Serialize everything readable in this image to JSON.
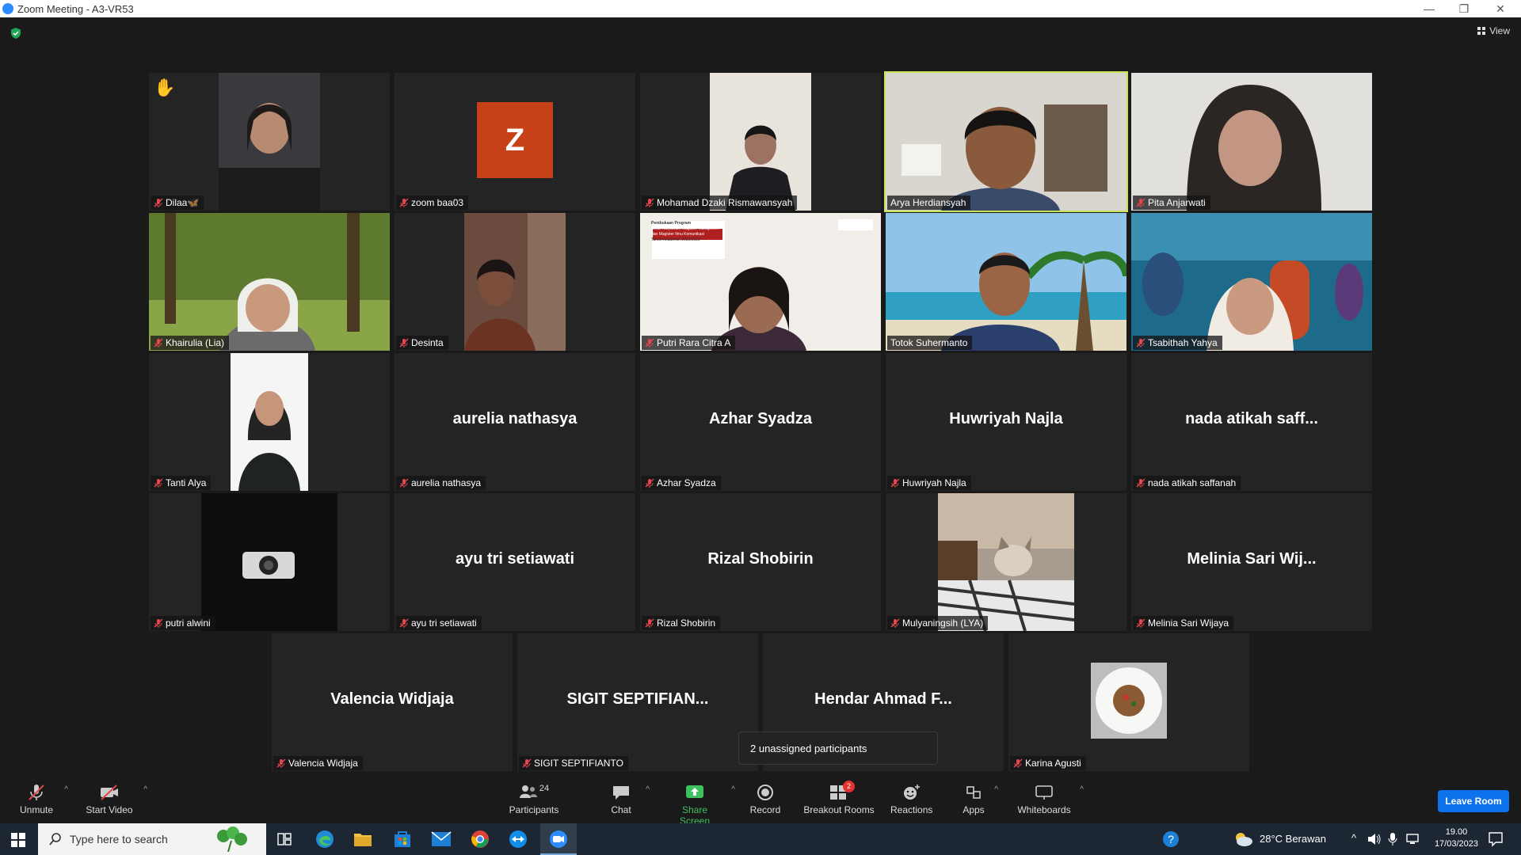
{
  "window": {
    "title": "Zoom Meeting - A3-VR53"
  },
  "view_button": "View",
  "tiles": [
    {
      "label": "Dilaa🦋",
      "display": ""
    },
    {
      "label": "zoom baa03",
      "display": "",
      "avatar_letter": "Z"
    },
    {
      "label": "Mohamad Dzaki Rismawansyah",
      "display": ""
    },
    {
      "label": "Arya Herdiansyah",
      "display": ""
    },
    {
      "label": "Pita Anjarwati",
      "display": ""
    },
    {
      "label": "Khairulia (Lia)",
      "display": ""
    },
    {
      "label": "Desinta",
      "display": ""
    },
    {
      "label": "Putri Rara Citra A",
      "display": "",
      "slide_text": [
        "Pembukaan Program",
        "Kelas Karyawan, Magister Manajemen",
        "dan Magister Ilmu Komunikasi",
        "Tahun Akademik 2022/2023"
      ]
    },
    {
      "label": "Totok Suhermanto",
      "display": ""
    },
    {
      "label": "Tsabithah Yahya",
      "display": ""
    },
    {
      "label": "Tanti Alya",
      "display": ""
    },
    {
      "label": "aurelia nathasya",
      "display": "aurelia nathasya"
    },
    {
      "label": "Azhar Syadza",
      "display": "Azhar Syadza"
    },
    {
      "label": "Huwriyah Najla",
      "display": "Huwriyah Najla"
    },
    {
      "label": "nada atikah saffanah",
      "display": "nada atikah saff..."
    },
    {
      "label": "putri alwini",
      "display": ""
    },
    {
      "label": "ayu tri setiawati",
      "display": "ayu tri setiawati"
    },
    {
      "label": "Rizal Shobirin",
      "display": "Rizal Shobirin"
    },
    {
      "label": "Mulyaningsih (LYA)",
      "display": ""
    },
    {
      "label": "Melinia Sari Wijaya",
      "display": "Melinia Sari Wij..."
    },
    {
      "label": "Valencia Widjaja",
      "display": "Valencia Widjaja"
    },
    {
      "label": "SIGIT SEPTIFIANTO",
      "display": "SIGIT  SEPTIFIAN..."
    },
    {
      "label": "",
      "display": "Hendar Ahmad F..."
    },
    {
      "label": "Karina Agusti",
      "display": ""
    }
  ],
  "popup": "2 unassigned participants",
  "toolbar": {
    "unmute": "Unmute",
    "start_video": "Start Video",
    "participants": "Participants",
    "participants_count": "24",
    "chat": "Chat",
    "share_screen": "Share Screen",
    "record": "Record",
    "breakout_rooms": "Breakout Rooms",
    "breakout_badge": "2",
    "reactions": "Reactions",
    "apps": "Apps",
    "whiteboards": "Whiteboards",
    "leave": "Leave Room"
  },
  "taskbar": {
    "search_placeholder": "Type here to search",
    "weather": "28°C  Berawan",
    "time": "19.00",
    "date": "17/03/2023"
  },
  "colors": {
    "accent_blue": "#0e72ed",
    "speaking": "#c8e35a",
    "share_green": "#3ec15f",
    "avatar_orange": "#c64117"
  }
}
